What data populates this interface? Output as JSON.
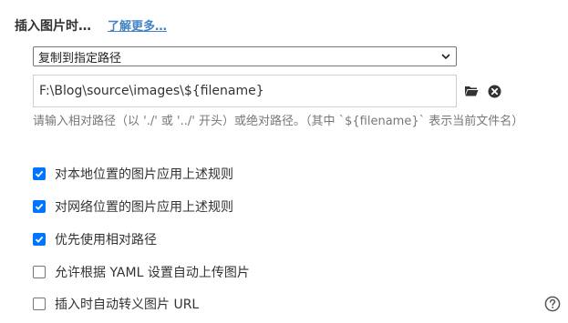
{
  "header": {
    "title": "插入图片时…",
    "learn_more": "了解更多…"
  },
  "action_select": {
    "value": "复制到指定路径"
  },
  "path_input": {
    "value": "F:\\Blog\\source\\images\\${filename}"
  },
  "hint": "请输入相对路径（以 './' 或 '../' 开头）或绝对路径。（其中 `${filename}` 表示当前文件名）",
  "options": [
    {
      "label": "对本地位置的图片应用上述规则",
      "checked": true
    },
    {
      "label": "对网络位置的图片应用上述规则",
      "checked": true
    },
    {
      "label": "优先使用相对路径",
      "checked": true
    },
    {
      "label": "允许根据 YAML 设置自动上传图片",
      "checked": false
    },
    {
      "label": "插入时自动转义图片 URL",
      "checked": false
    }
  ],
  "icons": {
    "folder": "folder-icon",
    "clear": "close-circle-icon",
    "help": "help-circle-icon",
    "dropdown": "chevron-down-icon"
  },
  "colors": {
    "link": "#4183c4",
    "checkbox_checked": "#0075ff",
    "hint_text": "#777777"
  }
}
